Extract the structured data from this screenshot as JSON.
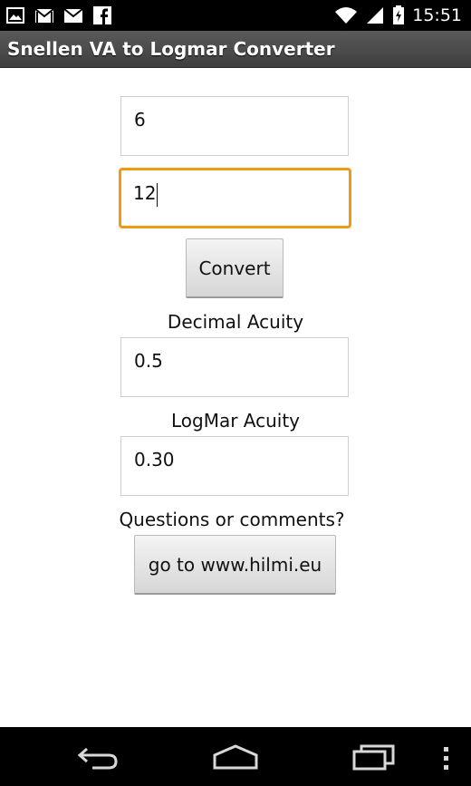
{
  "status_bar": {
    "time": "15:51",
    "left_icons": [
      "image-icon",
      "gmail-icon",
      "mail-icon",
      "facebook-icon"
    ],
    "right_icons": [
      "wifi-icon",
      "signal-icon",
      "battery-charging-icon"
    ]
  },
  "app": {
    "title": "Snellen VA to Logmar Converter"
  },
  "form": {
    "numerator_value": "6",
    "denominator_value": "12",
    "convert_label": "Convert",
    "decimal_label": "Decimal Acuity",
    "decimal_value": "0.5",
    "logmar_label": "LogMar Acuity",
    "logmar_value": "0.30",
    "questions_label": "Questions or comments?",
    "website_button_label": "go to www.hilmi.eu"
  },
  "nav_bar": {
    "icons": [
      "back-icon",
      "home-icon",
      "recents-icon",
      "overflow-menu-icon"
    ]
  },
  "colors": {
    "focus_accent": "#f09a12",
    "title_bar": "#4a4a4a",
    "status_bar": "#000000"
  }
}
